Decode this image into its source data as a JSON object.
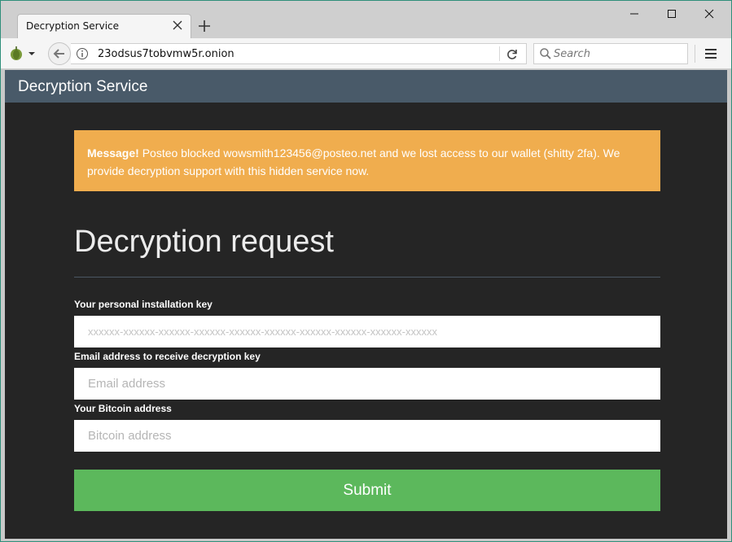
{
  "browser": {
    "tab": {
      "title": "Decryption Service"
    },
    "url": "23odsus7tobvmw5r.onion",
    "search": {
      "placeholder": "Search"
    }
  },
  "site": {
    "brand": "Decryption Service",
    "alert": {
      "strong": "Message!",
      "text": " Posteo blocked wowsmith123456@posteo.net and we lost access to our wallet (shitty 2fa). We provide decryption support with this hidden service now."
    },
    "heading": "Decryption request",
    "form": {
      "key_label": "Your personal installation key",
      "key_placeholder": "xxxxxx-xxxxxx-xxxxxx-xxxxxx-xxxxxx-xxxxxx-xxxxxx-xxxxxx-xxxxxx-xxxxxx",
      "email_label": "Email address to receive decryption key",
      "email_placeholder": "Email address",
      "btc_label": "Your Bitcoin address",
      "btc_placeholder": "Bitcoin address",
      "submit_label": "Submit"
    }
  },
  "colors": {
    "header": "#495a69",
    "page_bg": "#252525",
    "alert": "#f0ad4e",
    "submit": "#5cb85c"
  }
}
